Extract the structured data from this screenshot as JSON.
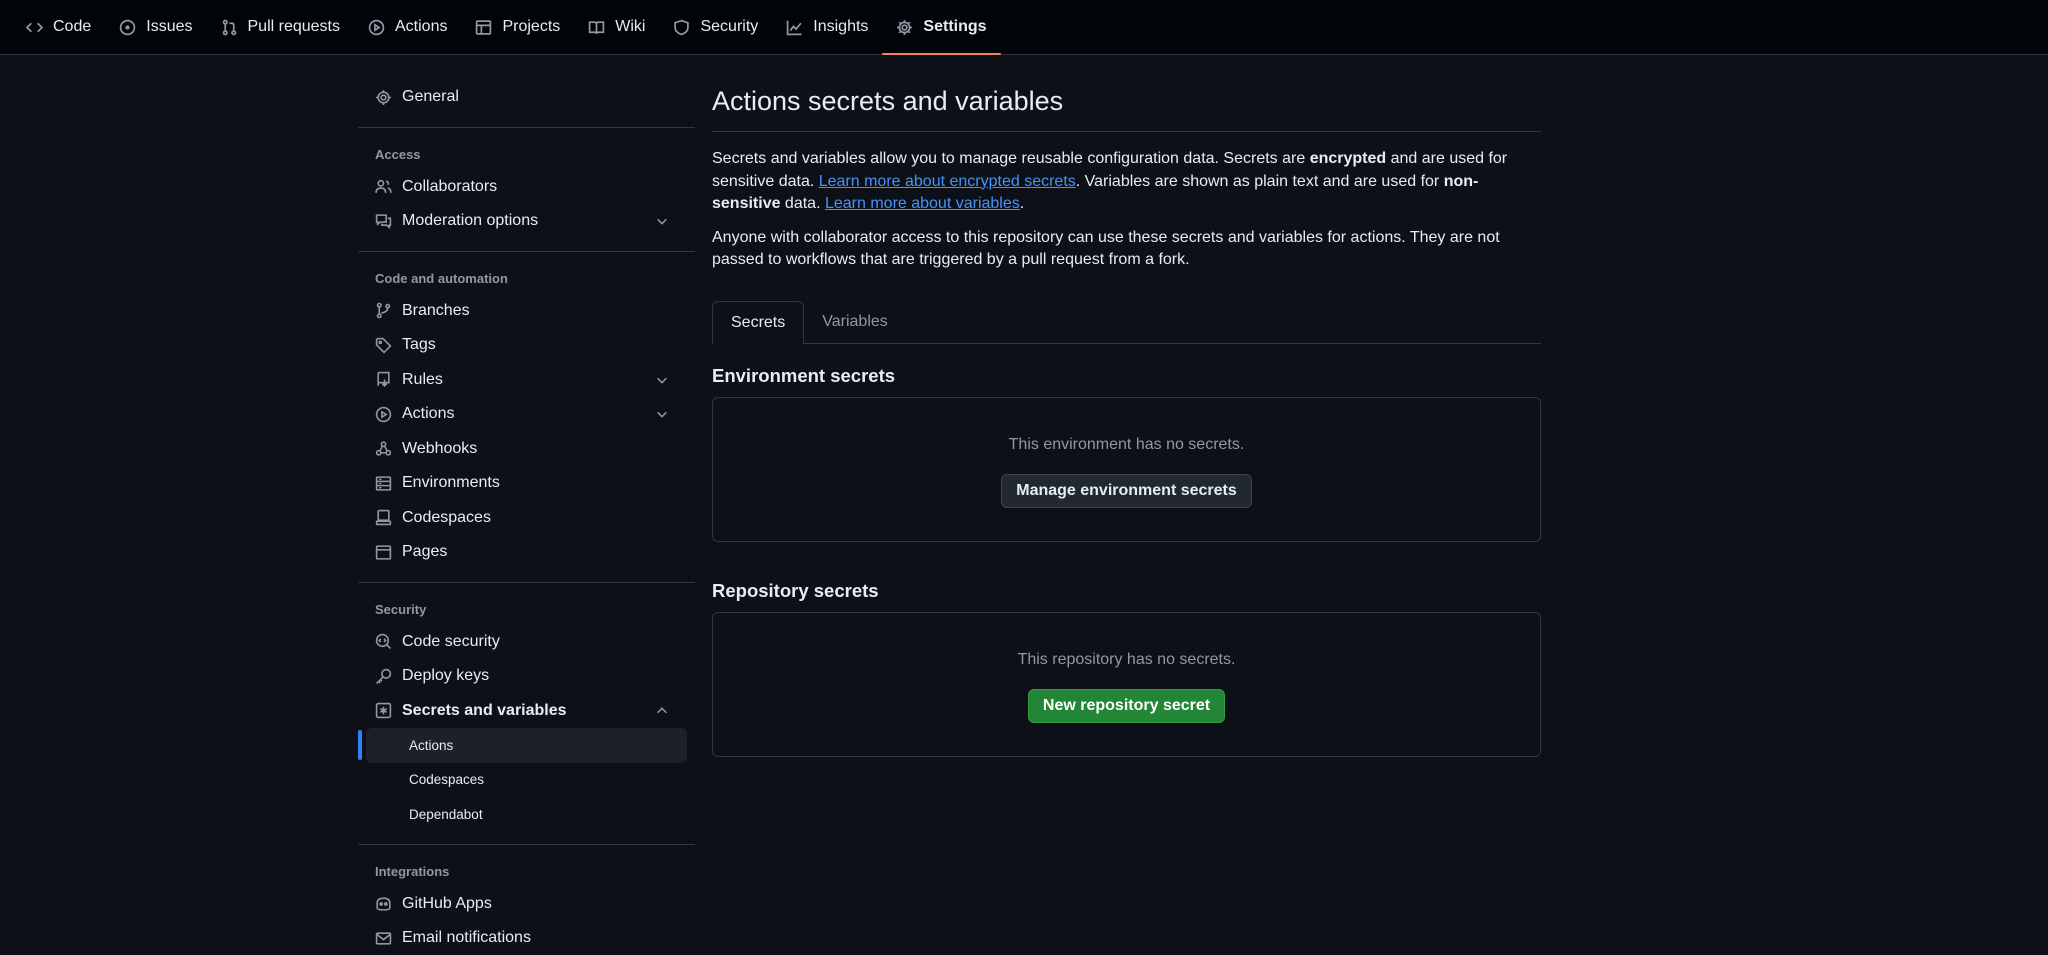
{
  "repo_nav": {
    "tabs": [
      {
        "label": "Code",
        "icon": "code-icon"
      },
      {
        "label": "Issues",
        "icon": "issue-opened-icon"
      },
      {
        "label": "Pull requests",
        "icon": "git-pull-request-icon"
      },
      {
        "label": "Actions",
        "icon": "play-icon"
      },
      {
        "label": "Projects",
        "icon": "table-icon"
      },
      {
        "label": "Wiki",
        "icon": "book-icon"
      },
      {
        "label": "Security",
        "icon": "shield-icon"
      },
      {
        "label": "Insights",
        "icon": "graph-icon"
      },
      {
        "label": "Settings",
        "icon": "gear-icon"
      }
    ],
    "active": "Settings",
    "active_color": "#f78166"
  },
  "sidebar": {
    "general": "General",
    "access": {
      "heading": "Access",
      "items": [
        "Collaborators",
        "Moderation options"
      ]
    },
    "code_automation": {
      "heading": "Code and automation",
      "items": [
        "Branches",
        "Tags",
        "Rules",
        "Actions",
        "Webhooks",
        "Environments",
        "Codespaces",
        "Pages"
      ]
    },
    "security": {
      "heading": "Security",
      "items": [
        "Code security",
        "Deploy keys",
        "Secrets and variables"
      ],
      "sub_items": [
        "Actions",
        "Codespaces",
        "Dependabot"
      ],
      "active_sub": "Actions"
    },
    "integrations": {
      "heading": "Integrations",
      "items": [
        "GitHub Apps",
        "Email notifications"
      ]
    }
  },
  "main": {
    "title": "Actions secrets and variables",
    "intro": {
      "p1_a": "Secrets and variables allow you to manage reusable configuration data. Secrets are ",
      "p1_b": "encrypted",
      "p1_c": " and are used for sensitive data. ",
      "link_secrets": "Learn more about encrypted secrets",
      "p1_d": ". Variables are shown as plain text and are used for ",
      "p1_e": "non-sensitive",
      "p1_f": " data. ",
      "link_variables": "Learn more about variables",
      "p1_g": "."
    },
    "access_note": "Anyone with collaborator access to this repository can use these secrets and variables for actions. They are not passed to workflows that are triggered by a pull request from a fork.",
    "tabs": [
      {
        "label": "Secrets",
        "active": true
      },
      {
        "label": "Variables",
        "active": false
      }
    ],
    "environment": {
      "title": "Environment secrets",
      "empty": "This environment has no secrets.",
      "button": "Manage environment secrets"
    },
    "repository": {
      "title": "Repository secrets",
      "empty": "This repository has no secrets.",
      "button": "New repository secret"
    }
  },
  "colors": {
    "background": "#0d1117",
    "header": "#010409",
    "link": "#4493f8",
    "primary_button": "#238636",
    "active_indicator": "#2f81f7"
  }
}
